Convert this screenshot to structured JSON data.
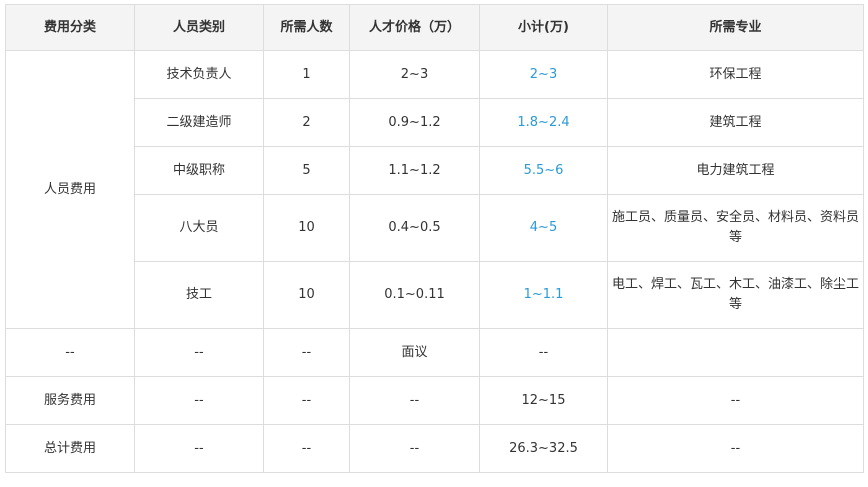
{
  "table": {
    "headers": [
      "费用分类",
      "人员类别",
      "所需人数",
      "人才价格（万）",
      "小计(万)",
      "所需专业"
    ],
    "personnel_category": "人员费用",
    "personnel_rows": [
      {
        "type": "技术负责人",
        "count": "1",
        "price": "2~3",
        "subtotal": "2~3",
        "major": "环保工程"
      },
      {
        "type": "二级建造师",
        "count": "2",
        "price": "0.9~1.2",
        "subtotal": "1.8~2.4",
        "major": "建筑工程"
      },
      {
        "type": "中级职称",
        "count": "5",
        "price": "1.1~1.2",
        "subtotal": "5.5~6",
        "major": "电力建筑工程"
      },
      {
        "type": "八大员",
        "count": "10",
        "price": "0.4~0.5",
        "subtotal": "4~5",
        "major": "施工员、质量员、安全员、材料员、资料员等"
      },
      {
        "type": "技工",
        "count": "10",
        "price": "0.1~0.11",
        "subtotal": "1~1.1",
        "major": "电工、焊工、瓦工、木工、油漆工、除尘工等"
      }
    ],
    "other_rows": [
      {
        "category": "--",
        "type": "--",
        "count": "--",
        "price": "面议",
        "subtotal": "--",
        "major": ""
      },
      {
        "category": "服务费用",
        "type": "--",
        "count": "--",
        "price": "--",
        "subtotal": "12~15",
        "major": "--"
      },
      {
        "category": "总计费用",
        "type": "--",
        "count": "--",
        "price": "--",
        "subtotal": "26.3~32.5",
        "major": "--"
      }
    ]
  },
  "colors": {
    "header_bg": "#f4f4f4",
    "border": "#dddddd",
    "text": "#333333",
    "subtotal_link": "#2a9ad8"
  }
}
